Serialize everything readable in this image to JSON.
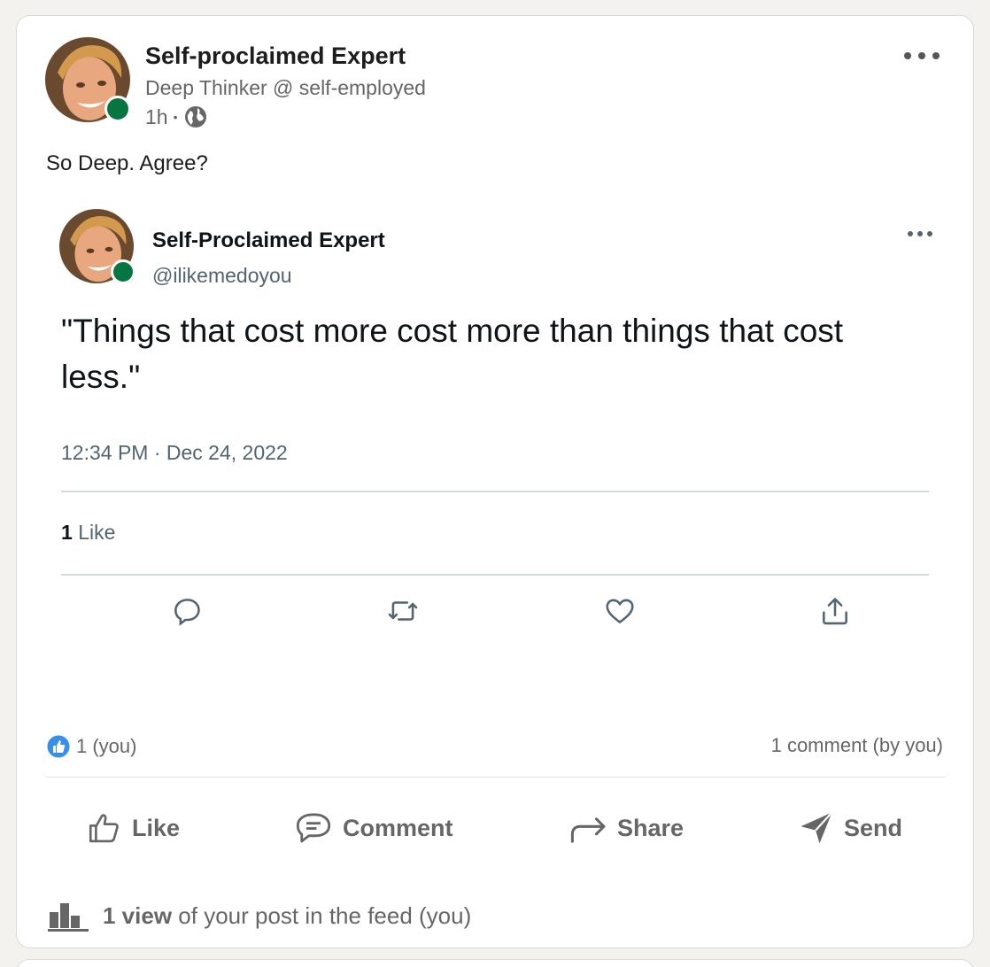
{
  "post": {
    "author_name": "Self-proclaimed Expert",
    "author_headline": "Deep Thinker @ self-employed",
    "time_ago": "1h",
    "separator": "•",
    "body": "So Deep. Agree?"
  },
  "tweet": {
    "name": "Self-Proclaimed Expert",
    "handle": "@ilikemedoyou",
    "text": "\"Things that cost more cost more than things that cost less.\"",
    "timestamp": "12:34 PM · Dec 24, 2022",
    "like_count": "1",
    "like_label": "Like"
  },
  "social": {
    "reactions": "1 (you)",
    "comments": "1 comment (by you)"
  },
  "actions": {
    "like": "Like",
    "comment": "Comment",
    "share": "Share",
    "send": "Send"
  },
  "analytics": {
    "views_bold": "1 view",
    "views_rest": "of your post in the feed (you)"
  },
  "colors": {
    "online": "#057642",
    "reaction_blue": "#378fe9",
    "tweet_secondary": "#536471"
  }
}
